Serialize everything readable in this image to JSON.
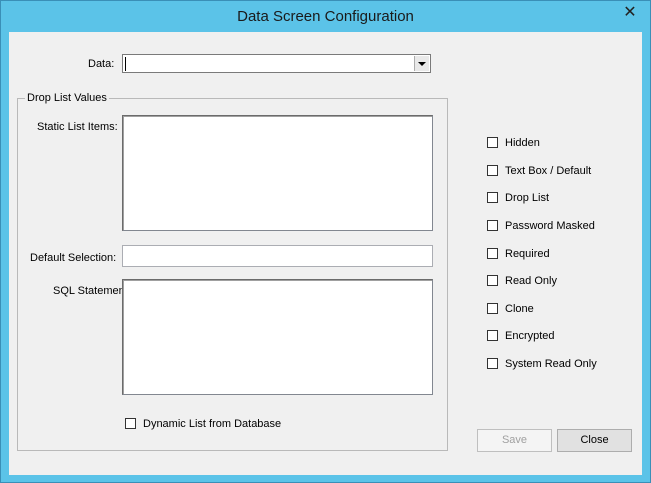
{
  "window": {
    "title": "Data Screen Configuration",
    "close_glyph": "✕"
  },
  "data_field": {
    "label": "Data:",
    "value": ""
  },
  "drop_list_group": {
    "title": "Drop List Values",
    "static_items_label": "Static List Items:",
    "static_items_value": "",
    "default_selection_label": "Default Selection:",
    "default_selection_value": "",
    "sql_statement_label": "SQL Statement:",
    "sql_statement_value": "",
    "dynamic_list_label": "Dynamic List from Database"
  },
  "options": [
    {
      "label": "Hidden",
      "checked": false
    },
    {
      "label": "Text Box / Default",
      "checked": false
    },
    {
      "label": "Drop List",
      "checked": false
    },
    {
      "label": "Password Masked",
      "checked": false
    },
    {
      "label": "Required",
      "checked": false
    },
    {
      "label": "Read Only",
      "checked": false
    },
    {
      "label": "Clone",
      "checked": false
    },
    {
      "label": "Encrypted",
      "checked": false
    },
    {
      "label": "System Read Only",
      "checked": false
    }
  ],
  "buttons": {
    "save": "Save",
    "close": "Close"
  }
}
